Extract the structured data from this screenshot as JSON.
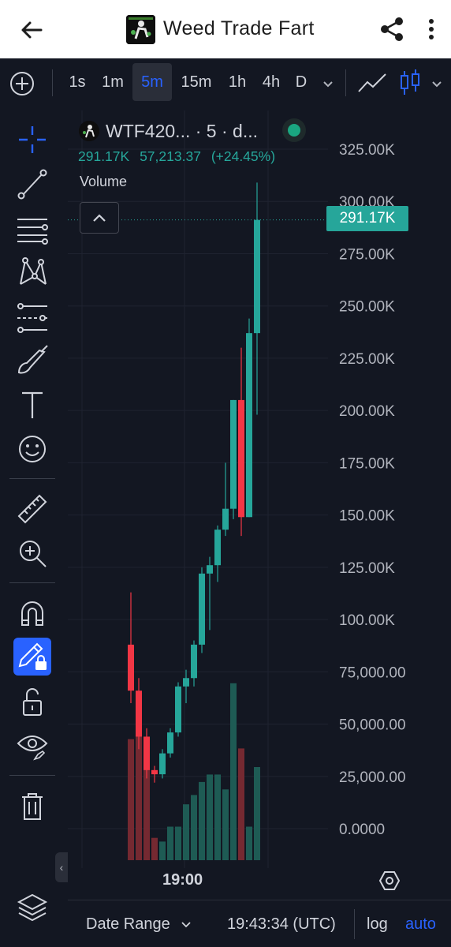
{
  "appbar": {
    "title": "Weed Trade Fart",
    "back_icon": "arrow-left-icon",
    "share_icon": "share-icon",
    "more_icon": "more-vertical-icon"
  },
  "toolbar": {
    "intervals": [
      {
        "label": "1s",
        "active": false
      },
      {
        "label": "1m",
        "active": false
      },
      {
        "label": "5m",
        "active": true
      },
      {
        "label": "15m",
        "active": false
      },
      {
        "label": "1h",
        "active": false
      },
      {
        "label": "4h",
        "active": false
      },
      {
        "label": "D",
        "active": false
      }
    ],
    "accent_color": "#2962ff"
  },
  "legend": {
    "symbol": "WTF420... · 5 · d...",
    "last_price": "291.17K",
    "change": "57,213.37",
    "change_pct": "(+24.45%)",
    "volume_label": "Volume",
    "up_color": "#26a69a"
  },
  "price_axis": {
    "labels": [
      "325.00K",
      "300.00K",
      "275.00K",
      "250.00K",
      "225.00K",
      "200.00K",
      "175.00K",
      "150.00K",
      "125.00K",
      "100.00K",
      "75,000.00",
      "50,000.00",
      "25,000.00",
      "0.0000"
    ],
    "current_price_tag": "291.17K"
  },
  "time_axis": {
    "label": "19:00"
  },
  "bottombar": {
    "date_range": "Date Range",
    "clock": "19:43:34 (UTC)",
    "log": "log",
    "auto": "auto"
  },
  "chart_data": {
    "type": "candlestick",
    "up_color": "#26a69a",
    "down_color": "#f23645",
    "price_range": [
      0,
      325000
    ],
    "candles": [
      {
        "open": 88000,
        "high": 113000,
        "low": 60000,
        "close": 66000
      },
      {
        "open": 66000,
        "high": 72000,
        "low": 38000,
        "close": 44000
      },
      {
        "open": 44000,
        "high": 48000,
        "low": 24000,
        "close": 28000
      },
      {
        "open": 28000,
        "high": 30000,
        "low": 22000,
        "close": 26000
      },
      {
        "open": 26000,
        "high": 38000,
        "low": 24000,
        "close": 36000
      },
      {
        "open": 36000,
        "high": 48000,
        "low": 34000,
        "close": 46000
      },
      {
        "open": 46000,
        "high": 70000,
        "low": 44000,
        "close": 68000
      },
      {
        "open": 68000,
        "high": 76000,
        "low": 60000,
        "close": 72000
      },
      {
        "open": 72000,
        "high": 90000,
        "low": 68000,
        "close": 88000
      },
      {
        "open": 88000,
        "high": 125000,
        "low": 84000,
        "close": 122000
      },
      {
        "open": 122000,
        "high": 130000,
        "low": 95000,
        "close": 126000
      },
      {
        "open": 126000,
        "high": 145000,
        "low": 118000,
        "close": 143000
      },
      {
        "open": 143000,
        "high": 175000,
        "low": 140000,
        "close": 153000
      },
      {
        "open": 153000,
        "high": 205000,
        "low": 148000,
        "close": 205000
      },
      {
        "open": 205000,
        "high": 230000,
        "low": 140000,
        "close": 149000
      },
      {
        "open": 149000,
        "high": 244000,
        "low": 149000,
        "close": 237000
      },
      {
        "open": 237000,
        "high": 309000,
        "low": 198000,
        "close": 291170
      }
    ],
    "volume_axis_range": [
      0,
      100000
    ],
    "volumes": [
      65000,
      80000,
      50000,
      12000,
      10000,
      18000,
      18000,
      30000,
      35000,
      42000,
      46000,
      46000,
      38000,
      95000,
      60000,
      18000,
      50000
    ]
  }
}
